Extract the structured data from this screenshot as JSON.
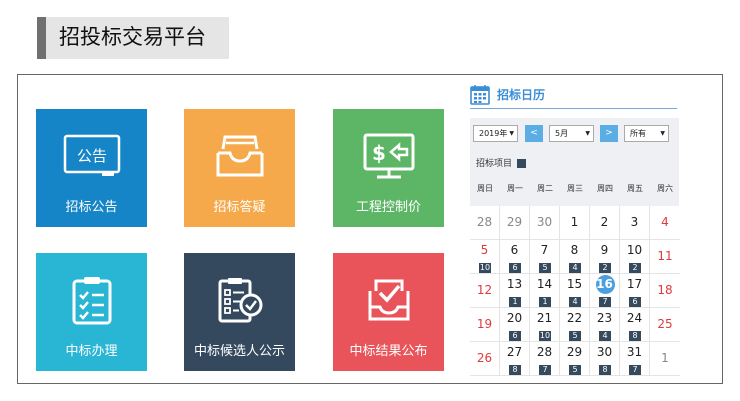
{
  "header": {
    "title": "招投标交易平台"
  },
  "tiles": [
    {
      "label": "招标公告",
      "icon": "announcement-board-icon",
      "icon_text": "公告",
      "color": "#1585c8"
    },
    {
      "label": "招标答疑",
      "icon": "inbox-tray-icon",
      "color": "#f5a94a"
    },
    {
      "label": "工程控制价",
      "icon": "price-monitor-icon",
      "icon_text": "$",
      "color": "#5db566"
    },
    {
      "label": "中标办理",
      "icon": "clipboard-checklist-icon",
      "color": "#29b5d4"
    },
    {
      "label": "中标候选人公示",
      "icon": "document-check-icon",
      "color": "#34495e"
    },
    {
      "label": "中标结果公布",
      "icon": "tray-check-icon",
      "color": "#e8545a"
    }
  ],
  "calendar": {
    "title": "招标日历",
    "title_icon": "calendar-icon",
    "year_select": "2019年",
    "month_select": "5月",
    "type_select": "所有",
    "prev_label": "<",
    "next_label": ">",
    "legend_label": "招标项目",
    "weekdays": [
      "周日",
      "周一",
      "周二",
      "周三",
      "周四",
      "周五",
      "周六"
    ],
    "weeks": [
      [
        {
          "d": "28",
          "muted": true
        },
        {
          "d": "29",
          "muted": true
        },
        {
          "d": "30",
          "muted": true
        },
        {
          "d": "1"
        },
        {
          "d": "2"
        },
        {
          "d": "3"
        },
        {
          "d": "4",
          "red": true
        }
      ],
      [
        {
          "d": "5",
          "red": true,
          "b": "10"
        },
        {
          "d": "6",
          "b": "6"
        },
        {
          "d": "7",
          "b": "5"
        },
        {
          "d": "8",
          "b": "4"
        },
        {
          "d": "9",
          "b": "2"
        },
        {
          "d": "10",
          "b": "2"
        },
        {
          "d": "11",
          "red": true
        }
      ],
      [
        {
          "d": "12",
          "red": true
        },
        {
          "d": "13",
          "b": "1"
        },
        {
          "d": "14",
          "b": "1"
        },
        {
          "d": "15",
          "b": "4"
        },
        {
          "d": "16",
          "b": "7",
          "today": true
        },
        {
          "d": "17",
          "b": "6"
        },
        {
          "d": "18",
          "red": true
        }
      ],
      [
        {
          "d": "19",
          "red": true
        },
        {
          "d": "20",
          "b": "6"
        },
        {
          "d": "21",
          "b": "10"
        },
        {
          "d": "22",
          "b": "5"
        },
        {
          "d": "23",
          "b": "4"
        },
        {
          "d": "24",
          "b": "8"
        },
        {
          "d": "25",
          "red": true
        }
      ],
      [
        {
          "d": "26",
          "red": true
        },
        {
          "d": "27",
          "b": "8"
        },
        {
          "d": "28",
          "b": "7"
        },
        {
          "d": "29",
          "b": "5"
        },
        {
          "d": "30",
          "b": "8"
        },
        {
          "d": "31",
          "b": "7"
        },
        {
          "d": "1",
          "muted": true
        }
      ]
    ],
    "colors": {
      "red": "#e03a3a",
      "muted": "#888888",
      "normal": "#222222",
      "badge": "#364a5e",
      "today": "#4a9fe0"
    }
  }
}
